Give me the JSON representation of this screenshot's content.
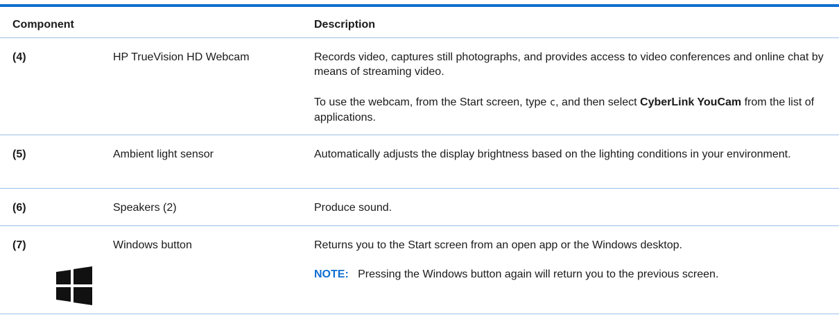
{
  "header": {
    "component": "Component",
    "description": "Description"
  },
  "rows": [
    {
      "num": "(4)",
      "name": "HP TrueVision HD Webcam",
      "desc1": "Records video, captures still photographs, and provides access to video conferences and online chat by means of streaming video.",
      "desc2_pre": "To use the webcam, from the Start screen, type ",
      "desc2_code": "c",
      "desc2_mid": ", and then select ",
      "desc2_bold": "CyberLink YouCam",
      "desc2_post": " from the list of applications."
    },
    {
      "num": "(5)",
      "name": "Ambient light sensor",
      "desc1": "Automatically adjusts the display brightness based on the lighting conditions in your environment."
    },
    {
      "num": "(6)",
      "name": "Speakers (2)",
      "desc1": "Produce sound."
    },
    {
      "num": "(7)",
      "name": "Windows button",
      "icon": "windows-logo-icon",
      "desc1": "Returns you to the Start screen from an open app or the Windows desktop.",
      "note_label": "NOTE:",
      "note_text": "Pressing the Windows button again will return you to the previous screen."
    }
  ],
  "colors": {
    "accent": "#0f6fd1",
    "separator": "#9bbfe6"
  }
}
